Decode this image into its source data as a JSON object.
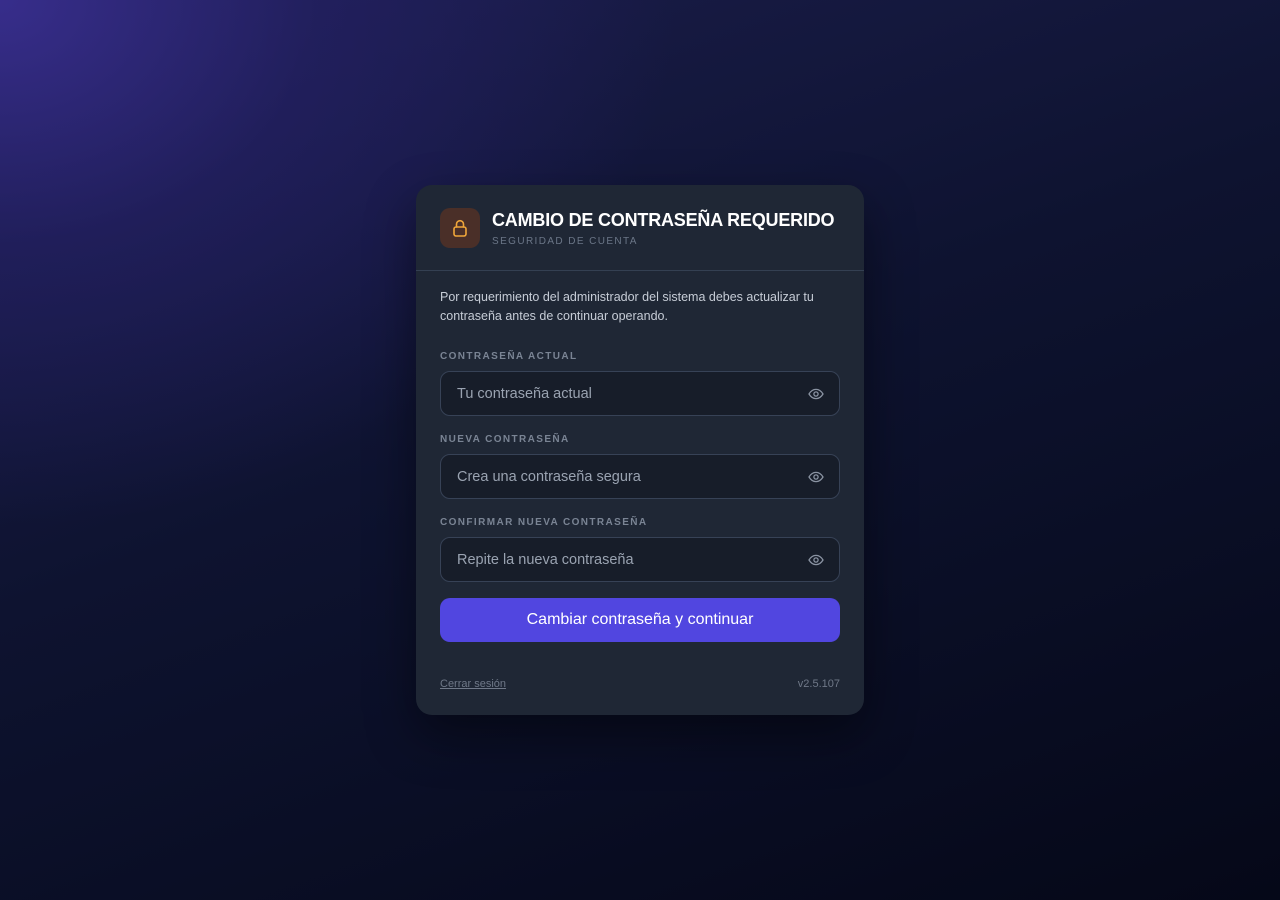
{
  "header": {
    "title": "CAMBIO DE CONTRASEÑA REQUERIDO",
    "subtitle": "SEGURIDAD DE CUENTA",
    "icon": "lock-icon",
    "icon_color": "#f0a63a"
  },
  "intro": "Por requerimiento del administrador del sistema debes actualizar tu contraseña antes de continuar operando.",
  "fields": [
    {
      "label": "CONTRASEÑA ACTUAL",
      "placeholder": "Tu contraseña actual",
      "value": ""
    },
    {
      "label": "NUEVA CONTRASEÑA",
      "placeholder": "Crea una contraseña segura",
      "value": ""
    },
    {
      "label": "CONFIRMAR NUEVA CONTRASEÑA",
      "placeholder": "Repite la nueva contraseña",
      "value": ""
    }
  ],
  "submit_label": "Cambiar contraseña y continuar",
  "footer": {
    "logout_label": "Cerrar sesión",
    "version": "v2.5.107"
  },
  "colors": {
    "accent": "#5146e0",
    "card_bg": "#1f2735"
  }
}
